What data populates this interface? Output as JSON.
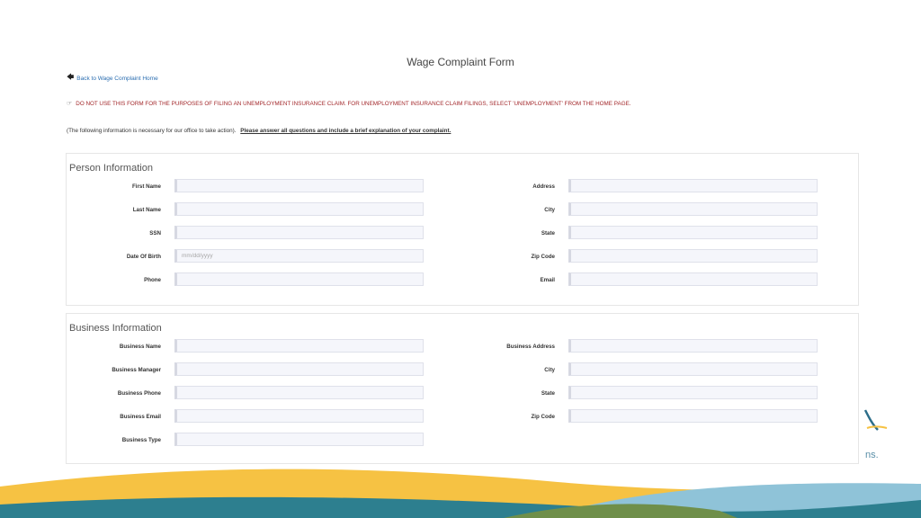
{
  "header": {
    "title": "Wage Complaint Form",
    "back_link": "Back to Wage Complaint Home"
  },
  "notices": {
    "warning": "DO NOT USE THIS FORM FOR THE PURPOSES OF FILING AN UNEMPLOYMENT INSURANCE CLAIM. FOR UNEMPLOYMENT INSURANCE CLAIM FILINGS, SELECT 'UNEMPLOYMENT' FROM THE HOME PAGE.",
    "info_prefix": "(The following information is necessary for our office to take action).",
    "info_bold": "Please answer all questions and include a brief explanation of your complaint."
  },
  "person": {
    "title": "Person Information",
    "first_name": "First Name",
    "last_name": "Last Name",
    "ssn": "SSN",
    "dob": "Date Of Birth",
    "dob_placeholder": "mm/dd/yyyy",
    "phone": "Phone",
    "address": "Address",
    "city": "City",
    "state": "State",
    "zip": "Zip Code",
    "email": "Email"
  },
  "business": {
    "title": "Business Information",
    "name": "Business Name",
    "manager": "Business Manager",
    "phone": "Business Phone",
    "email": "Business Email",
    "type": "Business Type",
    "address": "Business Address",
    "city": "City",
    "state": "State",
    "zip": "Zip Code"
  },
  "branding": {
    "logo_text": "ns."
  },
  "colors": {
    "warning": "#a3282b",
    "link": "#2a6db0",
    "wave_yellow": "#f6c243",
    "wave_teal": "#2d7f8f",
    "wave_blue": "#8fc3d8",
    "wave_green": "#6f8f4a"
  }
}
